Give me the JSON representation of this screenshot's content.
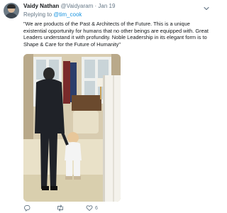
{
  "tweet": {
    "display_name": "Vaidy Nathan",
    "handle": "@Vaidyaram",
    "separator": "·",
    "date": "Jan 19",
    "reply_prefix": "Replying to",
    "reply_mention": "@tim_cook",
    "text": "\"We are products of the Past & Architects of the Future. This is a unique existential opportunity for humans that no other beings are equipped with. Great Leaders understand it with profundity. Noble Leadership in its elegant form is to Shape & Care for the Future of Humanity\"",
    "media_icon": "photo",
    "actions": {
      "reply_icon": "reply-icon",
      "retweet_icon": "retweet-icon",
      "like_icon": "heart-icon",
      "like_count": "6"
    }
  },
  "colors": {
    "text_primary": "#14171a",
    "text_secondary": "#657786",
    "link": "#1b95e0"
  }
}
